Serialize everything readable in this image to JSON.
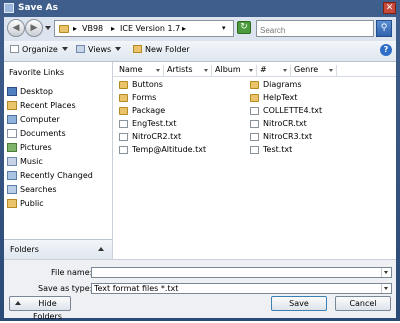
{
  "window": {
    "title": "Save As",
    "close_glyph": "✕"
  },
  "address": {
    "crumbs": [
      "VB98",
      "ICE Version 1.7"
    ],
    "search_placeholder": "Search"
  },
  "toolbar": {
    "organize": "Organize",
    "views": "Views",
    "new_folder": "New Folder",
    "help": "?"
  },
  "nav": {
    "favorites_heading": "Favorite Links",
    "items": [
      {
        "label": "Desktop",
        "icon": "desktop-icon"
      },
      {
        "label": "Recent Places",
        "icon": "recent-places-icon"
      },
      {
        "label": "Computer",
        "icon": "computer-icon"
      },
      {
        "label": "Documents",
        "icon": "documents-icon"
      },
      {
        "label": "Pictures",
        "icon": "pictures-icon"
      },
      {
        "label": "Music",
        "icon": "music-icon"
      },
      {
        "label": "Recently Changed",
        "icon": "recently-changed-icon"
      },
      {
        "label": "Searches",
        "icon": "searches-icon"
      },
      {
        "label": "Public",
        "icon": "public-icon"
      }
    ],
    "folders_label": "Folders"
  },
  "columns": [
    "Name",
    "Artists",
    "Album",
    "#",
    "Genre"
  ],
  "files": {
    "col1": [
      {
        "name": "Buttons",
        "kind": "folder"
      },
      {
        "name": "Forms",
        "kind": "folder"
      },
      {
        "name": "Package",
        "kind": "folder"
      },
      {
        "name": "EngTest.txt",
        "kind": "text"
      },
      {
        "name": "NitroCR2.txt",
        "kind": "text"
      },
      {
        "name": "Temp@Altitude.txt",
        "kind": "text"
      }
    ],
    "col2": [
      {
        "name": "Diagrams",
        "kind": "folder"
      },
      {
        "name": "HelpText",
        "kind": "folder"
      },
      {
        "name": "COLLETTE4.txt",
        "kind": "text"
      },
      {
        "name": "NitroCR.txt",
        "kind": "text"
      },
      {
        "name": "NitroCR3.txt",
        "kind": "text"
      },
      {
        "name": "Test.txt",
        "kind": "text"
      }
    ]
  },
  "form": {
    "file_name_label": "File name:",
    "file_name_value": "",
    "save_type_label": "Save as type:",
    "save_type_value": "Text format files *.txt"
  },
  "buttons": {
    "hide_folders": "Hide Folders",
    "save": "Save",
    "cancel": "Cancel"
  },
  "colors": {
    "folder": "#e9c46a",
    "title_bar": "#3f5e8c",
    "accent": "#2e6ec8"
  }
}
